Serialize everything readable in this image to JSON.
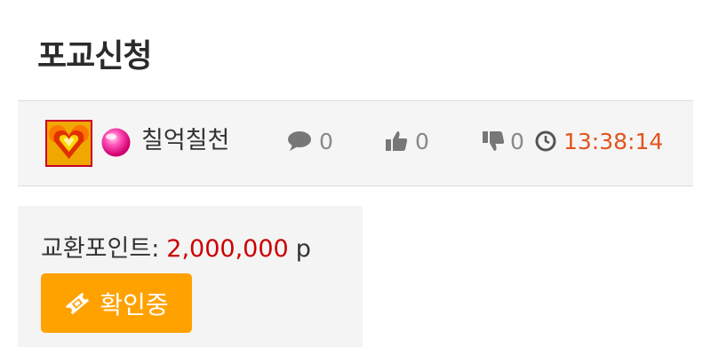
{
  "page": {
    "title": "포교신청"
  },
  "author": {
    "nickname": "칠억칠천",
    "avatar_icon": "flame-heart-avatar",
    "level_icon": "pink-orb-badge"
  },
  "stats": {
    "comments": "0",
    "likes": "0",
    "dislikes": "0",
    "time": "13:38:14"
  },
  "exchange": {
    "label": "교환포인트:",
    "value": "2,000,000",
    "unit": "p",
    "status_label": "확인중"
  },
  "colors": {
    "accent": "#e2541e",
    "points": "#cc0000",
    "button": "#ffa200"
  }
}
